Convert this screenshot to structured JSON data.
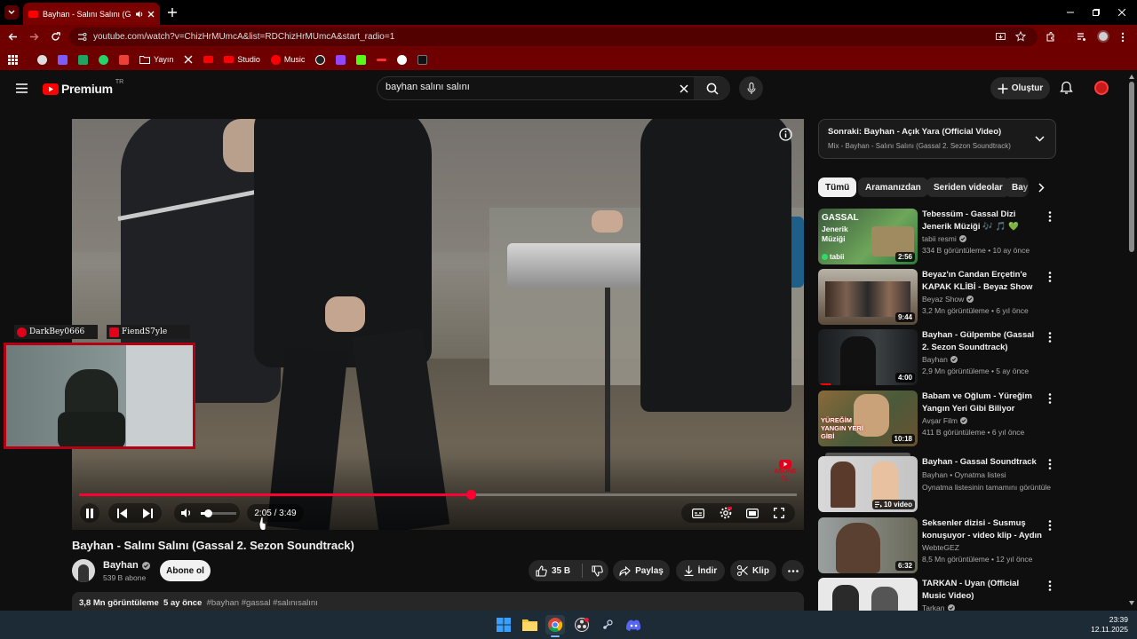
{
  "browser": {
    "tab_title": "Bayhan - Salını Salını (Gass…",
    "url": "youtube.com/watch?v=ChizHrMUmcA&list=RDChizHrMUmcA&start_radio=1",
    "bookmarks": [
      "Yayın",
      "Studio",
      "Music"
    ]
  },
  "header": {
    "logo_text": "Premium",
    "logo_sup": "TR",
    "search_value": "bayhan salını salını",
    "create_label": "Oluştur"
  },
  "player": {
    "time": "2:05 / 3:49",
    "progress_fraction": 0.546,
    "volume_fraction": 0.2,
    "subscribe_badge_line1": "ABONE",
    "subscribe_badge_line2": "OL"
  },
  "overlay": {
    "user1": "DarkBey0666",
    "user2": "FiendS7yle"
  },
  "video": {
    "title": "Bayhan - Salını Salını (Gassal 2. Sezon Soundtrack)",
    "channel": "Bayhan",
    "subscribers": "539 B abone",
    "subscribe_label": "Abone ol",
    "likes": "35 B",
    "share_label": "Paylaş",
    "download_label": "İndir",
    "clip_label": "Klip",
    "views": "3,8 Mn görüntüleme",
    "age": "5 ay önce",
    "hashtags": "#bayhan #gassal #salınısalını"
  },
  "up_next": {
    "label": "Sonraki:",
    "title": "Bayhan - Açık Yara (Official Video)",
    "subtitle": "Mix - Bayhan - Salını Salını (Gassal 2. Sezon Soundtrack)"
  },
  "chips": [
    "Tümü",
    "Aramanızdan",
    "Seriden videolar",
    "Bay"
  ],
  "recommendations": [
    {
      "title": "Tebessüm - Gassal Dizi Jenerik Müziği 🎶 🎵 💚",
      "channel": "tabii resmi",
      "meta": "334 B görüntüleme • 10 ay önce",
      "duration": "2:56",
      "thumb_text": "GASSAL",
      "thumb_sub": "Jenerik Müziği",
      "thumb_brand": "tabii",
      "color": "#2c7a3c"
    },
    {
      "title": "Beyaz'ın Candan Erçetin'e KAPAK KLİBİ - Beyaz Show",
      "channel": "Beyaz Show",
      "meta": "3,2 Mn görüntüleme • 6 yıl önce",
      "duration": "9:44",
      "color": "#6a5a4a"
    },
    {
      "title": "Bayhan - Gülpembe (Gassal 2. Sezon Soundtrack)",
      "channel": "Bayhan",
      "meta": "2,9 Mn görüntüleme • 5 ay önce",
      "duration": "4:00",
      "color": "#3a3f42"
    },
    {
      "title": "Babam ve Oğlum - Yüreğim Yangın Yeri Gibi Biliyor Musun…",
      "channel": "Avşar Film",
      "meta": "411 B görüntüleme • 6 yıl önce",
      "duration": "10:18",
      "thumb_text": "YÜREĞİM YANGIN YERİ GİBİ",
      "color": "#6a5230"
    },
    {
      "title": "Bayhan - Gassal Soundtrack",
      "channel": "Bayhan • Oynatma listesi",
      "meta": "Oynatma listesinin tamamını görüntüle",
      "duration": "10 video",
      "color": "#c8c8c8"
    },
    {
      "title": "Seksenler dizisi - Susmuş konuşuyor - video klip - Aydın …",
      "channel": "WebteGEZ",
      "meta": "8,5 Mn görüntüleme • 12 yıl önce",
      "duration": "6:32",
      "color": "#7a7060"
    },
    {
      "title": "TARKAN - Uyan (Official Music Video)",
      "channel": "Tarkan",
      "meta": "",
      "duration": "",
      "color": "#e8e8e8"
    }
  ],
  "taskbar": {
    "time": "23:39",
    "date": "12.11.2025"
  }
}
